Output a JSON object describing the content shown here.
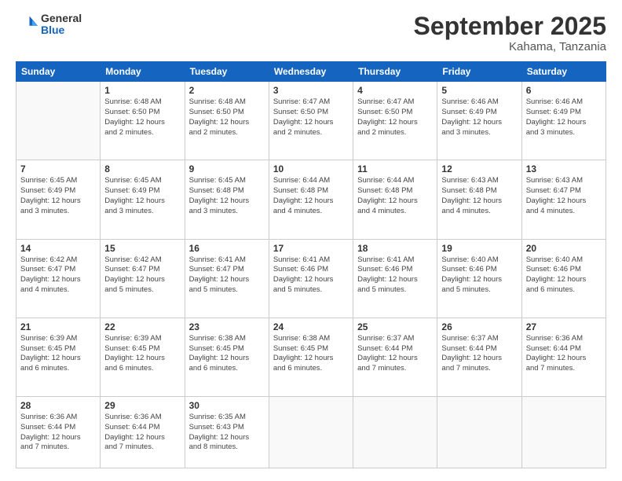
{
  "header": {
    "logo_general": "General",
    "logo_blue": "Blue",
    "month_title": "September 2025",
    "location": "Kahama, Tanzania"
  },
  "days_of_week": [
    "Sunday",
    "Monday",
    "Tuesday",
    "Wednesday",
    "Thursday",
    "Friday",
    "Saturday"
  ],
  "weeks": [
    [
      {
        "day": "",
        "info": ""
      },
      {
        "day": "1",
        "info": "Sunrise: 6:48 AM\nSunset: 6:50 PM\nDaylight: 12 hours\nand 2 minutes."
      },
      {
        "day": "2",
        "info": "Sunrise: 6:48 AM\nSunset: 6:50 PM\nDaylight: 12 hours\nand 2 minutes."
      },
      {
        "day": "3",
        "info": "Sunrise: 6:47 AM\nSunset: 6:50 PM\nDaylight: 12 hours\nand 2 minutes."
      },
      {
        "day": "4",
        "info": "Sunrise: 6:47 AM\nSunset: 6:50 PM\nDaylight: 12 hours\nand 2 minutes."
      },
      {
        "day": "5",
        "info": "Sunrise: 6:46 AM\nSunset: 6:49 PM\nDaylight: 12 hours\nand 3 minutes."
      },
      {
        "day": "6",
        "info": "Sunrise: 6:46 AM\nSunset: 6:49 PM\nDaylight: 12 hours\nand 3 minutes."
      }
    ],
    [
      {
        "day": "7",
        "info": "Sunrise: 6:45 AM\nSunset: 6:49 PM\nDaylight: 12 hours\nand 3 minutes."
      },
      {
        "day": "8",
        "info": "Sunrise: 6:45 AM\nSunset: 6:49 PM\nDaylight: 12 hours\nand 3 minutes."
      },
      {
        "day": "9",
        "info": "Sunrise: 6:45 AM\nSunset: 6:48 PM\nDaylight: 12 hours\nand 3 minutes."
      },
      {
        "day": "10",
        "info": "Sunrise: 6:44 AM\nSunset: 6:48 PM\nDaylight: 12 hours\nand 4 minutes."
      },
      {
        "day": "11",
        "info": "Sunrise: 6:44 AM\nSunset: 6:48 PM\nDaylight: 12 hours\nand 4 minutes."
      },
      {
        "day": "12",
        "info": "Sunrise: 6:43 AM\nSunset: 6:48 PM\nDaylight: 12 hours\nand 4 minutes."
      },
      {
        "day": "13",
        "info": "Sunrise: 6:43 AM\nSunset: 6:47 PM\nDaylight: 12 hours\nand 4 minutes."
      }
    ],
    [
      {
        "day": "14",
        "info": "Sunrise: 6:42 AM\nSunset: 6:47 PM\nDaylight: 12 hours\nand 4 minutes."
      },
      {
        "day": "15",
        "info": "Sunrise: 6:42 AM\nSunset: 6:47 PM\nDaylight: 12 hours\nand 5 minutes."
      },
      {
        "day": "16",
        "info": "Sunrise: 6:41 AM\nSunset: 6:47 PM\nDaylight: 12 hours\nand 5 minutes."
      },
      {
        "day": "17",
        "info": "Sunrise: 6:41 AM\nSunset: 6:46 PM\nDaylight: 12 hours\nand 5 minutes."
      },
      {
        "day": "18",
        "info": "Sunrise: 6:41 AM\nSunset: 6:46 PM\nDaylight: 12 hours\nand 5 minutes."
      },
      {
        "day": "19",
        "info": "Sunrise: 6:40 AM\nSunset: 6:46 PM\nDaylight: 12 hours\nand 5 minutes."
      },
      {
        "day": "20",
        "info": "Sunrise: 6:40 AM\nSunset: 6:46 PM\nDaylight: 12 hours\nand 6 minutes."
      }
    ],
    [
      {
        "day": "21",
        "info": "Sunrise: 6:39 AM\nSunset: 6:45 PM\nDaylight: 12 hours\nand 6 minutes."
      },
      {
        "day": "22",
        "info": "Sunrise: 6:39 AM\nSunset: 6:45 PM\nDaylight: 12 hours\nand 6 minutes."
      },
      {
        "day": "23",
        "info": "Sunrise: 6:38 AM\nSunset: 6:45 PM\nDaylight: 12 hours\nand 6 minutes."
      },
      {
        "day": "24",
        "info": "Sunrise: 6:38 AM\nSunset: 6:45 PM\nDaylight: 12 hours\nand 6 minutes."
      },
      {
        "day": "25",
        "info": "Sunrise: 6:37 AM\nSunset: 6:44 PM\nDaylight: 12 hours\nand 7 minutes."
      },
      {
        "day": "26",
        "info": "Sunrise: 6:37 AM\nSunset: 6:44 PM\nDaylight: 12 hours\nand 7 minutes."
      },
      {
        "day": "27",
        "info": "Sunrise: 6:36 AM\nSunset: 6:44 PM\nDaylight: 12 hours\nand 7 minutes."
      }
    ],
    [
      {
        "day": "28",
        "info": "Sunrise: 6:36 AM\nSunset: 6:44 PM\nDaylight: 12 hours\nand 7 minutes."
      },
      {
        "day": "29",
        "info": "Sunrise: 6:36 AM\nSunset: 6:44 PM\nDaylight: 12 hours\nand 7 minutes."
      },
      {
        "day": "30",
        "info": "Sunrise: 6:35 AM\nSunset: 6:43 PM\nDaylight: 12 hours\nand 8 minutes."
      },
      {
        "day": "",
        "info": ""
      },
      {
        "day": "",
        "info": ""
      },
      {
        "day": "",
        "info": ""
      },
      {
        "day": "",
        "info": ""
      }
    ]
  ]
}
